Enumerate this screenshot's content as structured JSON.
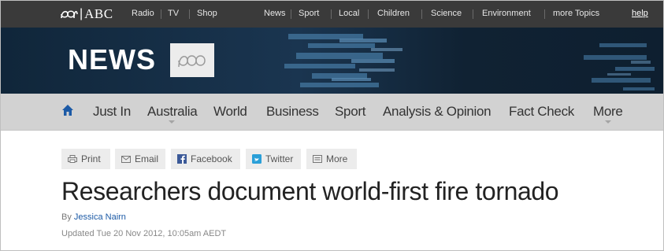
{
  "topbar": {
    "logo_text": "ABC",
    "links": [
      "Radio",
      "TV",
      "Shop",
      "News",
      "Sport",
      "Local",
      "Children",
      "Science",
      "Environment",
      "more Topics"
    ],
    "help": "help"
  },
  "banner": {
    "title": "NEWS"
  },
  "nav": {
    "items": [
      "Just In",
      "Australia",
      "World",
      "Business",
      "Sport",
      "Analysis & Opinion",
      "Fact Check",
      "More"
    ]
  },
  "share": {
    "print": "Print",
    "email": "Email",
    "facebook": "Facebook",
    "twitter": "Twitter",
    "more": "More"
  },
  "article": {
    "headline": "Researchers document world-first fire tornado",
    "by_prefix": "By",
    "author": "Jessica Nairn",
    "updated": "Updated Tue 20 Nov 2012, 10:05am AEDT"
  },
  "colors": {
    "topbar": "#3a3a3a",
    "banner": "#142a3d",
    "nav": "#d2d2d2",
    "link_blue": "#1c5aa6",
    "home_icon": "#1c5aa6"
  },
  "icons": [
    "abc-logo-icon",
    "home-icon",
    "print-icon",
    "email-icon",
    "facebook-icon",
    "twitter-icon",
    "more-icon"
  ]
}
